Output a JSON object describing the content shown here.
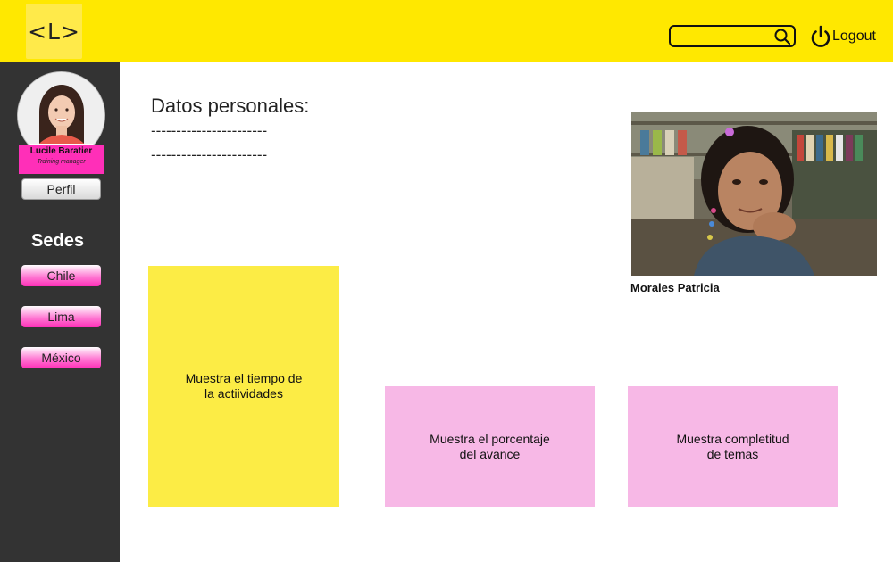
{
  "header": {
    "logo_text": "<L>",
    "search": {
      "value": "",
      "placeholder": ""
    },
    "logout_label": "Logout"
  },
  "sidebar": {
    "user": {
      "name": "Lucile Baratier",
      "role": "Training manager"
    },
    "profile_button": "Perfil",
    "section_title": "Sedes",
    "sedes": [
      "Chile",
      "Lima",
      "México"
    ]
  },
  "main": {
    "title": "Datos personales:",
    "dash_lines": [
      "-----------------------",
      "-----------------------"
    ],
    "student_name": "Morales Patricia",
    "cards": {
      "tiempo": {
        "line1": "Muestra el tiempo de",
        "line2": "la actiividades"
      },
      "porcentaje": {
        "line1": "Muestra el porcentaje",
        "line2": "del avance"
      },
      "completitud": {
        "line1": "Muestra completitud",
        "line2": "de temas"
      }
    }
  },
  "colors": {
    "header": "#ffe800",
    "sidebar": "#333333",
    "accent_pink": "#ff2fb8",
    "card_yellow": "#fcec45",
    "card_pink": "#f7b8e6"
  }
}
